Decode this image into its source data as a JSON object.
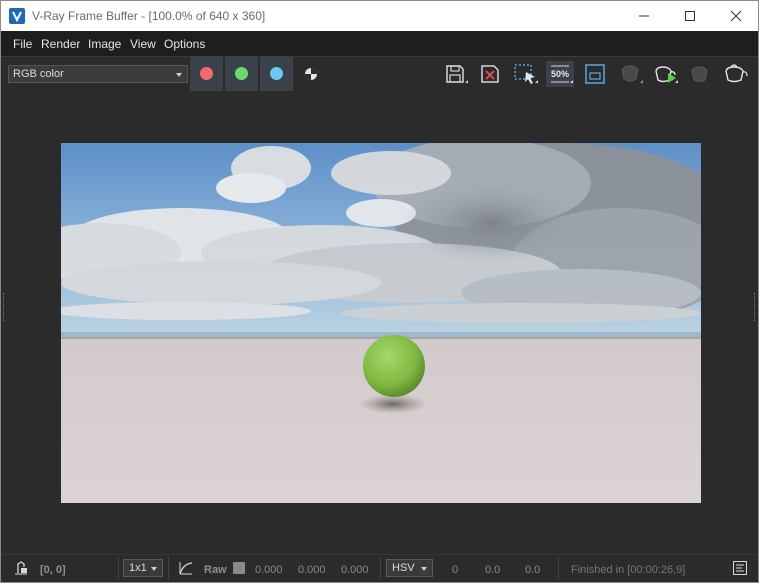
{
  "window": {
    "title": "V-Ray Frame Buffer - [100.0% of 640 x 360]"
  },
  "menu": {
    "items": [
      "File",
      "Render",
      "Image",
      "View",
      "Options"
    ]
  },
  "toolbar": {
    "channel_select": "RGB color",
    "channel_colors": {
      "red": "#f16b6b",
      "green": "#6bdc6b",
      "blue": "#6bc8f0"
    }
  },
  "status": {
    "coords": "[0, 0]",
    "sample_size": "1x1",
    "raw_label": "Raw",
    "raw_values": [
      "0.000",
      "0.000",
      "0.000"
    ],
    "color_mode": "HSV",
    "hsv_values": [
      "0",
      "0.0",
      "0.0"
    ],
    "finished": "Finished in [00:00:26,9]"
  },
  "accent": "#1d69b6"
}
